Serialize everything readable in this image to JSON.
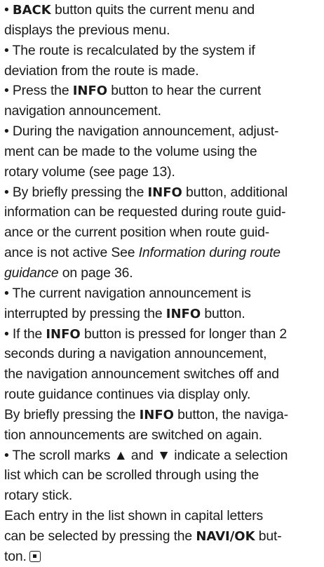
{
  "text": {
    "bullet": "•",
    "p1": {
      "kw": "BACK",
      "l1": " button quits the current menu and",
      "l2": "displays the previous menu."
    },
    "p2": {
      "l1": "The route is recalculated by the system if",
      "l2": "deviation from the route is made."
    },
    "p3": {
      "pre": "Press the ",
      "kw": "INFO",
      "post": " button to hear the current",
      "l2": "navigation announcement."
    },
    "p4": {
      "l1": "During the navigation announcement, adjust-",
      "l2": "ment can be made to the volume using the",
      "l3": "rotary volume (see page 13)."
    },
    "p5": {
      "pre": "By briefly pressing the ",
      "kw": "INFO",
      "post": " button, additional",
      "l2": "information can be requested during route guid-",
      "l3": "ance or the current position when route guid-",
      "l4_pre": "ance is not active See ",
      "l4_italic": "Information during route",
      "l5_italic": "guidance",
      "l5_post": " on page 36."
    },
    "p6": {
      "l1": "The current navigation announcement is",
      "l2_pre": "interrupted by pressing the ",
      "l2_kw": "INFO",
      "l2_post": " button."
    },
    "p7": {
      "pre": "If the ",
      "kw": "INFO",
      "post": " button is pressed for longer than 2",
      "l2": "seconds during a navigation announcement,",
      "l3": "the navigation announcement switches off and",
      "l4": "route guidance continues via display only."
    },
    "p8": {
      "pre": "By briefly pressing the ",
      "kw": "INFO",
      "post": " button, the naviga-",
      "l2": "tion announcements are switched on again."
    },
    "p9": {
      "l1": "The scroll marks ▲ and ▼ indicate a selection",
      "l2": "list which can be scrolled through using the",
      "l3": "rotary stick."
    },
    "p10": {
      "l1": "Each entry in the list shown in capital letters",
      "l2_pre": "can be selected by pressing the ",
      "l2_kw": "NAVI/OK",
      "l2_post": " but-",
      "l3": "ton."
    }
  },
  "icons": {
    "end_mark": "end-of-section-icon"
  }
}
